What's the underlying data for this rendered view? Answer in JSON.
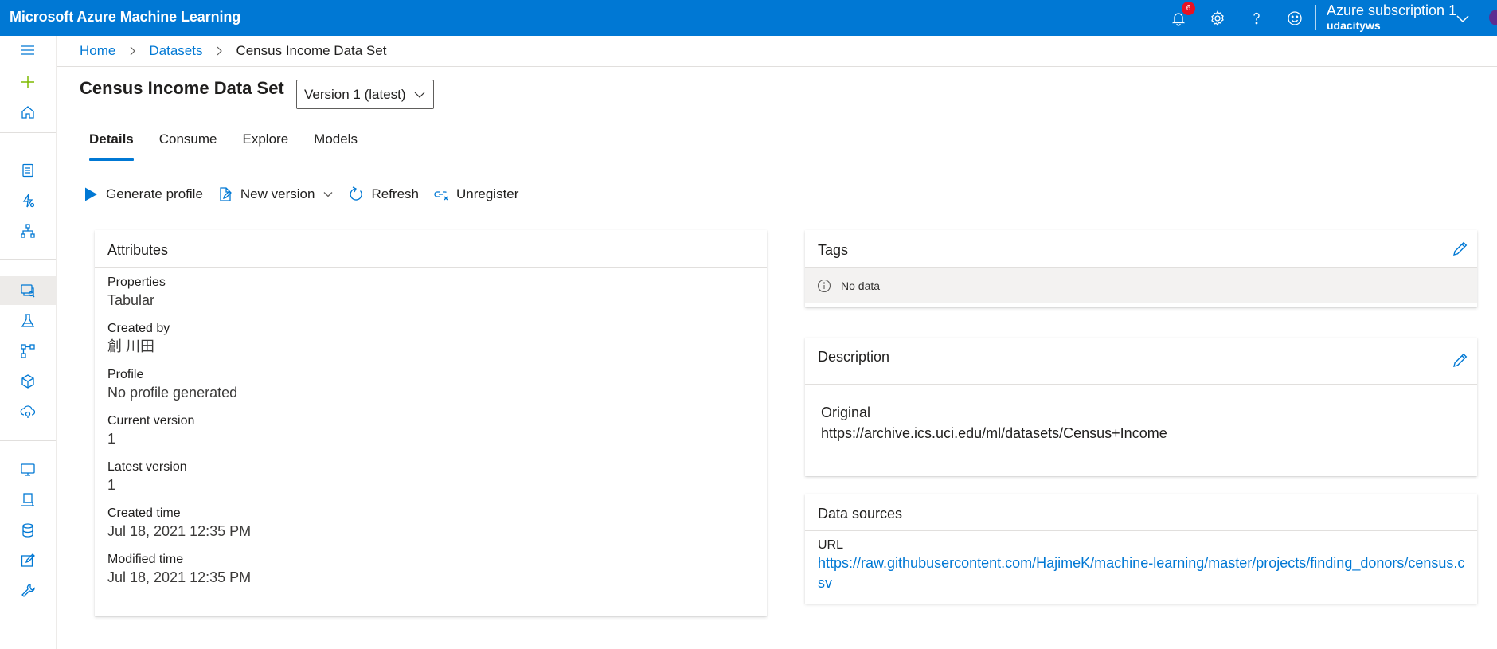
{
  "app": {
    "title": "Microsoft Azure Machine Learning",
    "notifications_count": "6",
    "account": {
      "subscription": "Azure subscription 1",
      "workspace": "udacityws"
    }
  },
  "icons": {
    "topbar": [
      "bell-icon",
      "gear-icon",
      "help-icon",
      "smiley-feedback-icon",
      "chevron-down-icon"
    ],
    "leftnav": [
      "hamburger-icon",
      "plus-icon",
      "home-icon",
      "notebook-icon",
      "automl-icon",
      "designer-icon",
      "datasets-icon",
      "experiments-icon",
      "pipelines-icon",
      "models-icon",
      "endpoints-icon",
      "compute-icon",
      "environments-icon",
      "datastores-icon",
      "data-labeling-icon",
      "linked-services-icon"
    ]
  },
  "breadcrumb": {
    "home": "Home",
    "datasets": "Datasets",
    "current": "Census Income Data Set"
  },
  "page": {
    "title": "Census Income Data Set",
    "version": "Version 1 (latest)"
  },
  "tabs": [
    {
      "label": "Details"
    },
    {
      "label": "Consume"
    },
    {
      "label": "Explore"
    },
    {
      "label": "Models"
    }
  ],
  "toolbar": {
    "generate_profile": "Generate profile",
    "new_version": "New version",
    "refresh": "Refresh",
    "unregister": "Unregister"
  },
  "attributes": {
    "title": "Attributes",
    "items": [
      {
        "label": "Properties",
        "value": "Tabular"
      },
      {
        "label": "Created by",
        "value": "創 川田"
      },
      {
        "label": "Profile",
        "value": "No profile generated"
      },
      {
        "label": "Current version",
        "value": "1"
      },
      {
        "label": "Latest version",
        "value": "1"
      },
      {
        "label": "Created time",
        "value": "Jul 18, 2021 12:35 PM"
      },
      {
        "label": "Modified time",
        "value": "Jul 18, 2021 12:35 PM"
      }
    ]
  },
  "tags": {
    "title": "Tags",
    "empty": "No data"
  },
  "description": {
    "title": "Description",
    "line1": "Original",
    "line2": "https://archive.ics.uci.edu/ml/datasets/Census+Income"
  },
  "data_sources": {
    "title": "Data sources",
    "label": "URL",
    "url": "https://raw.githubusercontent.com/HajimeK/machine-learning/master/projects/finding_donors/census.csv"
  },
  "colors": {
    "accent": "#0078d4",
    "badge": "#e81123",
    "nav_add": "#7fba00"
  }
}
